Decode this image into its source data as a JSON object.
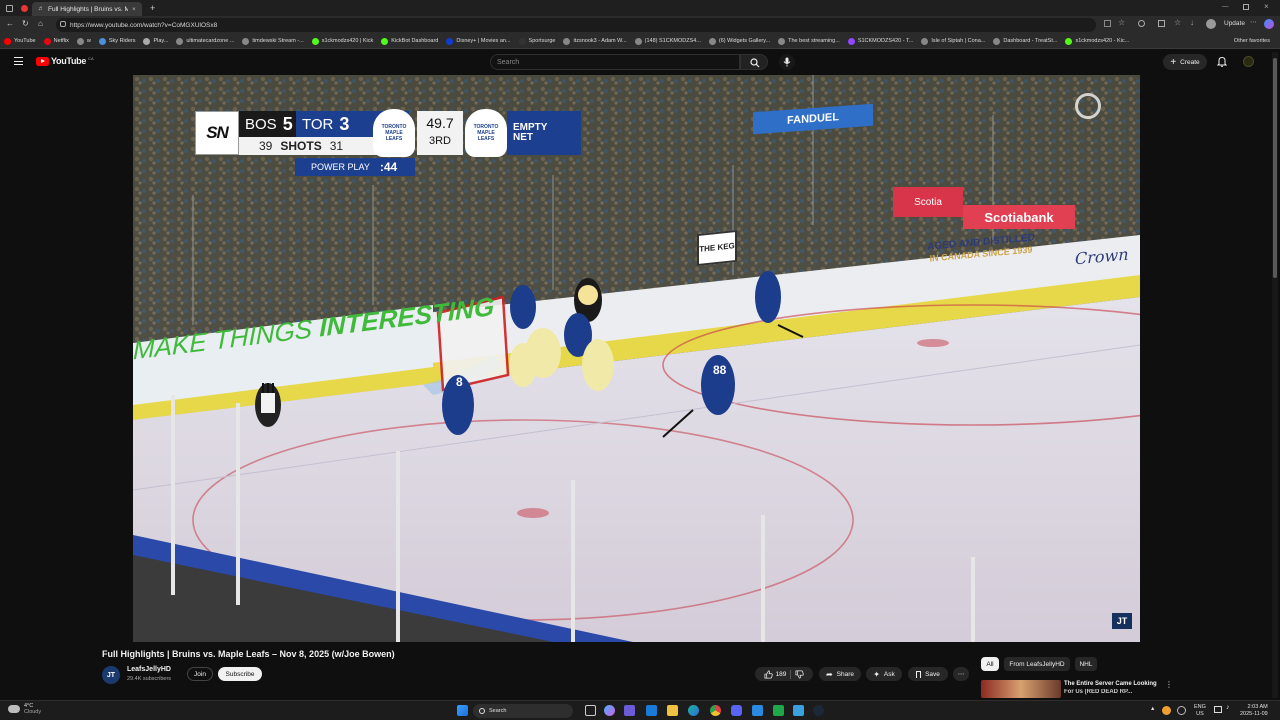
{
  "browser": {
    "tab_title": "Full Highlights | Bruins vs. M...",
    "url": "https://www.youtube.com/watch?v=CoMGXUlOSx8",
    "update_label": "Update",
    "bookmarks": [
      "YouTube",
      "Netflix",
      "w",
      "Sky Riders",
      "Play...",
      "ultimatecardzone ...",
      "timdewski Stream -...",
      "s1ckmodzs420 | Kick",
      "KickBot Dashboard",
      "Disney+ | Movies an...",
      "Sportsurge",
      "itzsnook3 - Adam W...",
      "(148) S1CKMODZS4...",
      "(6) Widgets Gallery...",
      "The best streaming...",
      "S1CKMODZS420 - T...",
      "Isle of Siptah | Cona...",
      "Dashboard - TreatSt...",
      "s1ckmodzs420 - Kic..."
    ],
    "other_favorites": "Other favorites"
  },
  "youtube": {
    "logo_text": "YouTube",
    "logo_region": "CA",
    "search_placeholder": "Search",
    "create_label": "Create"
  },
  "scorebug": {
    "network": "SN",
    "away_team": "BOS",
    "away_score": "5",
    "home_team": "TOR",
    "home_score": "3",
    "away_shots": "39",
    "shots_label": "SHOTS",
    "home_shots": "31",
    "clock": "49.7",
    "period": "3RD",
    "status_line1": "EMPTY",
    "status_line2": "NET",
    "pp_label": "POWER PLAY",
    "pp_time": ":44",
    "logo_text1": "TORONTO",
    "logo_text2": "MAPLE",
    "logo_text3": "LEAFS"
  },
  "arena": {
    "fanduel": "FANDUEL",
    "scotiabank": "Scotiabank",
    "scotia_small": "Scotia",
    "keg": "THE KEG",
    "aged": "AGED AND DISTILLED",
    "canada": "IN CANADA SINCE 1939",
    "crown": "Crown",
    "make_things": "MAKE THINGS",
    "interesting": "INTERESTING",
    "player_numbers": [
      "8",
      "88"
    ]
  },
  "video": {
    "title": "Full Highlights | Bruins vs. Maple Leafs – Nov 8, 2025 (w/Joe Bowen)",
    "channel_name": "LeafsJellyHD",
    "subscribers": "29.4K subscribers",
    "join_label": "Join",
    "subscribe_label": "Subscribe",
    "likes": "189",
    "share_label": "Share",
    "ask_label": "Ask",
    "save_label": "Save",
    "watermark": "JT"
  },
  "filters": [
    "All",
    "From LeafsJellyHD",
    "NHL"
  ],
  "recommended": {
    "title": "The Entire Server Came Looking",
    "title2": "For Us (RED DEAD RP..."
  },
  "taskbar": {
    "weather_temp": "4°C",
    "weather_desc": "Cloudy",
    "search_label": "Search",
    "lang1": "ENG",
    "lang2": "US",
    "time": "2:03 AM",
    "date": "2025-11-09"
  }
}
